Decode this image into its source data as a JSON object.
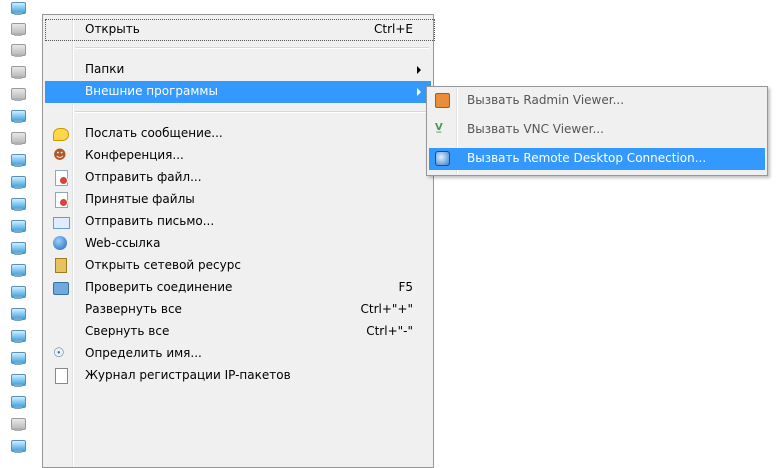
{
  "menu": {
    "items": [
      {
        "label": "Открыть",
        "shortcut": "Ctrl+E",
        "icon": "",
        "type": "item"
      },
      {
        "type": "separator"
      },
      {
        "label": "Папки",
        "shortcut": "",
        "icon": "",
        "type": "submenu"
      },
      {
        "label": "Внешние программы",
        "shortcut": "",
        "icon": "",
        "type": "submenu",
        "selected": true
      },
      {
        "type": "separator"
      },
      {
        "label": "Послать сообщение...",
        "shortcut": "",
        "icon": "message-bubble-icon",
        "type": "item"
      },
      {
        "label": "Конференция...",
        "shortcut": "",
        "icon": "conference-icon",
        "type": "item"
      },
      {
        "label": "Отправить файл...",
        "shortcut": "",
        "icon": "send-file-icon",
        "type": "item"
      },
      {
        "label": "Принятые файлы",
        "shortcut": "",
        "icon": "received-files-icon",
        "type": "item"
      },
      {
        "label": "Отправить письмо...",
        "shortcut": "",
        "icon": "envelope-icon",
        "type": "item"
      },
      {
        "label": "Web-ссылка",
        "shortcut": "",
        "icon": "globe-icon",
        "type": "item"
      },
      {
        "label": "Открыть сетевой ресурс",
        "shortcut": "",
        "icon": "network-resource-icon",
        "type": "item"
      },
      {
        "label": "Проверить соединение",
        "shortcut": "F5",
        "icon": "check-connection-icon",
        "type": "item"
      },
      {
        "label": "Развернуть все",
        "shortcut": "Ctrl+\"+\"",
        "icon": "",
        "type": "item"
      },
      {
        "label": "Свернуть все",
        "shortcut": "Ctrl+\"-\"",
        "icon": "",
        "type": "item"
      },
      {
        "label": "Определить имя...",
        "shortcut": "",
        "icon": "resolve-name-icon",
        "type": "item"
      },
      {
        "label": "Журнал регистрации IP-пакетов",
        "shortcut": "",
        "icon": "ip-log-icon",
        "type": "item"
      }
    ]
  },
  "submenu": {
    "items": [
      {
        "label": "Вызвать Radmin Viewer...",
        "icon": "radmin-viewer-icon"
      },
      {
        "label": "Вызвать VNC Viewer...",
        "icon": "vnc-viewer-icon"
      },
      {
        "label": "Вызвать Remote Desktop Connection...",
        "icon": "remote-desktop-icon",
        "selected": true
      }
    ]
  },
  "colors": {
    "selection": "#3399ff",
    "menu_bg": "#f0f0f0",
    "border": "#979797"
  }
}
